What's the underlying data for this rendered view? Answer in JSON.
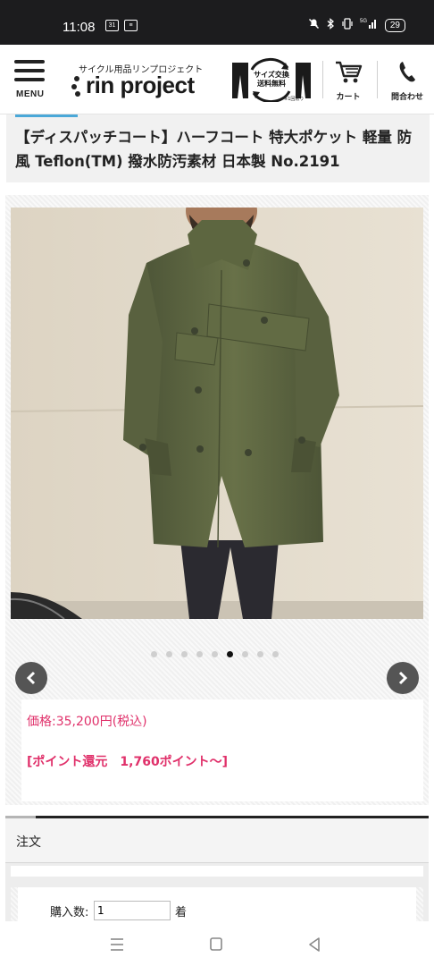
{
  "status_bar": {
    "time": "11:08",
    "left_icons": [
      "calendar-icon",
      "notification-icon"
    ],
    "calendar_day": "31",
    "right_icons": [
      "mute-icon",
      "bluetooth-icon",
      "vibrate-icon",
      "signal-5g-icon"
    ],
    "network": "5G",
    "battery": "29"
  },
  "header": {
    "menu_label": "MENU",
    "logo_tagline": "サイクル用品リンプロジェクト",
    "logo_name": "rin project",
    "badge_line1": "サイズ交換",
    "badge_line2": "送料無料",
    "badge_note": "※1回限り",
    "cart_label": "カート",
    "contact_label": "問合わせ"
  },
  "product": {
    "title": "【ディスパッチコート】ハーフコート 特大ポケット 軽量 防風 Teflon(TM) 撥水防汚素材 日本製 No.2191",
    "image_alt": "product-photo-coat",
    "slide_count": 9,
    "active_slide": 6,
    "price": "価格:35,200円(税込)",
    "points": "[ポイント還元　1,760ポイント〜]"
  },
  "order": {
    "title": "注文",
    "qty_label": "購入数:",
    "qty_value": "1",
    "qty_unit": "着"
  },
  "colors": {
    "price": "#e0306a",
    "accent": "#4aa8d8",
    "coat": "#5b6342"
  }
}
